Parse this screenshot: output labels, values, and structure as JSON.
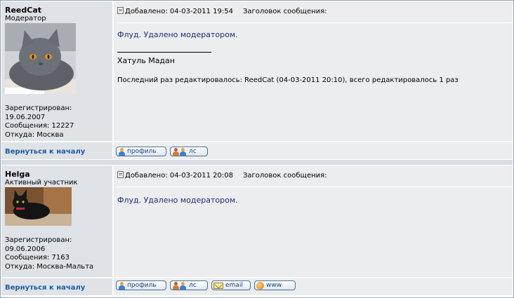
{
  "posts": [
    {
      "author": "ReedCat",
      "rank": "Модератор",
      "registered_label": "Зарегистрирован:",
      "registered_date": "19.06.2007",
      "messages": "Сообщения: 12227",
      "location": "Откуда: Москва",
      "posted": "Добавлено: 04-03-2011 19:54",
      "subject_label": "Заголовок сообщения:",
      "body": "Флуд. Удалено модератором.",
      "signature": "Хатуль Мадан",
      "edit_note": "Последний раз редактировалось: ReedCat (04-03-2011 20:10), всего редактировалось 1 раз",
      "back_to_top": "Вернуться к началу",
      "buttons": {
        "profile": "профиль",
        "pm": "лс"
      }
    },
    {
      "author": "Helga",
      "rank": "Активный участник",
      "registered_label": "Зарегистрирован:",
      "registered_date": "09.06.2006",
      "messages": "Сообщения: 7163",
      "location": "Откуда: Москва-Мальта",
      "posted": "Добавлено: 04-03-2011 20:08",
      "subject_label": "Заголовок сообщения:",
      "body": "Флуд. Удалено модератором.",
      "back_to_top": "Вернуться к началу",
      "buttons": {
        "profile": "профиль",
        "pm": "лс",
        "email": "email",
        "www": "www"
      }
    }
  ],
  "icons": [
    "post-icon",
    "profile-icon",
    "pm-icon",
    "email-icon",
    "www-icon"
  ],
  "colors": {
    "panel_left": "#dfe3e8",
    "panel_right": "#ebedef",
    "message_text": "#1d2c78",
    "link": "#1a5aa6",
    "border": "#8fa3b8"
  }
}
